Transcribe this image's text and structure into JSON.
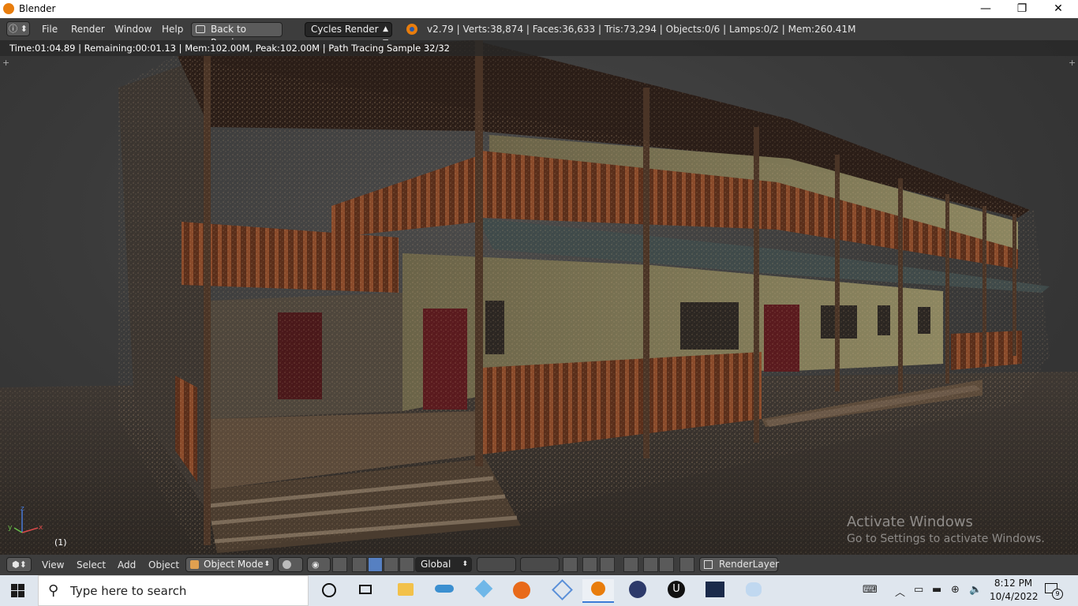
{
  "window": {
    "title": "Blender",
    "minimize": "—",
    "maximize": "❐",
    "close": "✕"
  },
  "top_header": {
    "editor_type_icon": "info-icon",
    "menus": [
      "File",
      "Render",
      "Window",
      "Help"
    ],
    "back_button": "Back to Previous",
    "render_engine": "Cycles Render",
    "stats": "v2.79 | Verts:38,874 | Faces:36,633 | Tris:73,294 | Objects:0/6 | Lamps:0/2 | Mem:260.41M"
  },
  "viewport": {
    "render_info": "Time:01:04.89 | Remaining:00:01.13 | Mem:102.00M, Peak:102.00M | Path Tracing Sample 32/32",
    "frame_label": "(1)",
    "axis_z": "z",
    "axis_y": "y",
    "axis_x": "x"
  },
  "bottom_header": {
    "menus": [
      "View",
      "Select",
      "Add",
      "Object"
    ],
    "mode": "Object Mode",
    "transform_orientation": "Global",
    "render_layer": "RenderLayer"
  },
  "watermark": {
    "line1": "Activate Windows",
    "line2": "Go to Settings to activate Windows."
  },
  "taskbar": {
    "search_placeholder": "Type here to search",
    "time": "8:12 PM",
    "date": "10/4/2022",
    "notification_count": "9"
  },
  "colors": {
    "blender_orange": "#e87d0d",
    "header_gray": "#3d3d3d",
    "taskbar_bg": "#dfe6ee"
  }
}
